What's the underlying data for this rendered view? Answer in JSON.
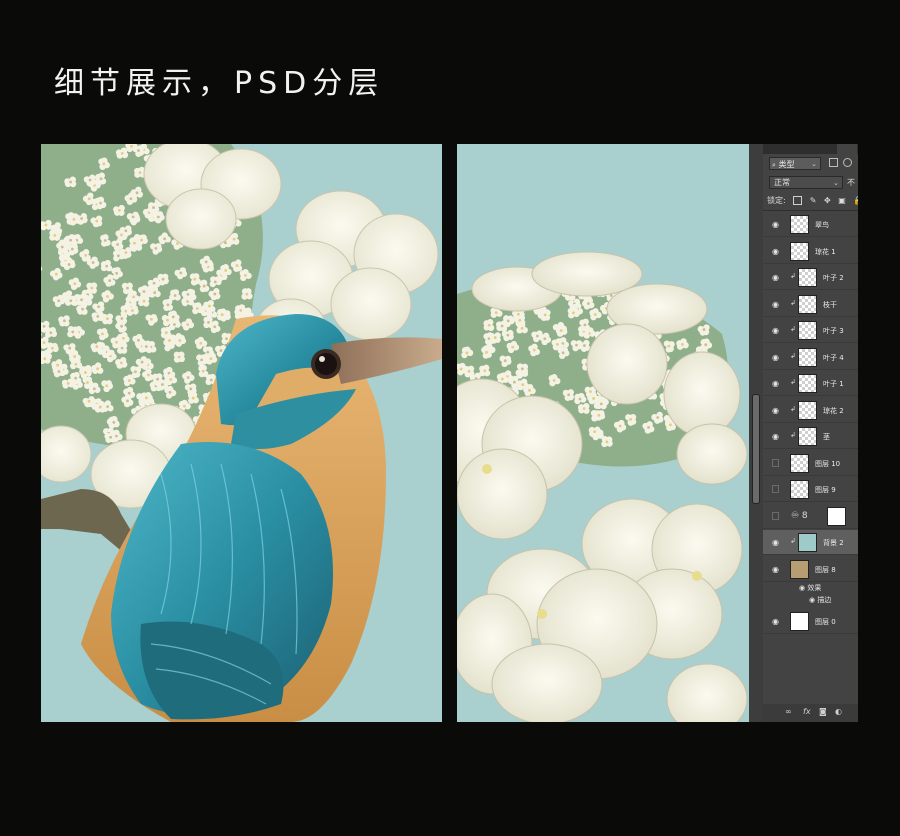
{
  "title": "细节展示，PSD分层",
  "layers_panel": {
    "filter_label": "类型",
    "blend_mode": "正常",
    "opacity_label": "不",
    "lock_label": "锁定:",
    "layers": [
      {
        "name": "翠鸟",
        "visible": true,
        "clipped": false,
        "thumb": "transparent"
      },
      {
        "name": "琼花 1",
        "visible": true,
        "clipped": false,
        "thumb": "transparent"
      },
      {
        "name": "叶子 2",
        "visible": true,
        "clipped": true,
        "thumb": "transparent"
      },
      {
        "name": "枝干",
        "visible": true,
        "clipped": true,
        "thumb": "transparent"
      },
      {
        "name": "叶子 3",
        "visible": true,
        "clipped": true,
        "thumb": "transparent"
      },
      {
        "name": "叶子 4",
        "visible": true,
        "clipped": true,
        "thumb": "transparent"
      },
      {
        "name": "叶子 1",
        "visible": true,
        "clipped": true,
        "thumb": "transparent"
      },
      {
        "name": "琼花 2",
        "visible": true,
        "clipped": true,
        "thumb": "transparent"
      },
      {
        "name": "茎",
        "visible": true,
        "clipped": true,
        "thumb": "transparent"
      },
      {
        "name": "图层 10",
        "visible": false,
        "clipped": false,
        "thumb": "transparent"
      },
      {
        "name": "图层 9",
        "visible": false,
        "clipped": false,
        "thumb": "transparent"
      },
      {
        "name": "",
        "visible": false,
        "clipped": false,
        "thumb": "adjustment"
      },
      {
        "name": "背景 2",
        "visible": true,
        "clipped": true,
        "thumb": "teal",
        "selected": true
      },
      {
        "name": "图层 8",
        "visible": true,
        "clipped": false,
        "thumb": "tan"
      },
      {
        "name": "图层 0",
        "visible": true,
        "clipped": false,
        "thumb": "white"
      }
    ],
    "effects_label": "效果",
    "effect_item": "描边",
    "footer_fx": "fx"
  },
  "colors": {
    "background": "#0a0a08",
    "canvas_teal": "#a9cfcf",
    "kingfisher_blue": "#2a8fa3",
    "kingfisher_orange": "#d9a25c",
    "flower_cream": "#f3f1e3"
  }
}
